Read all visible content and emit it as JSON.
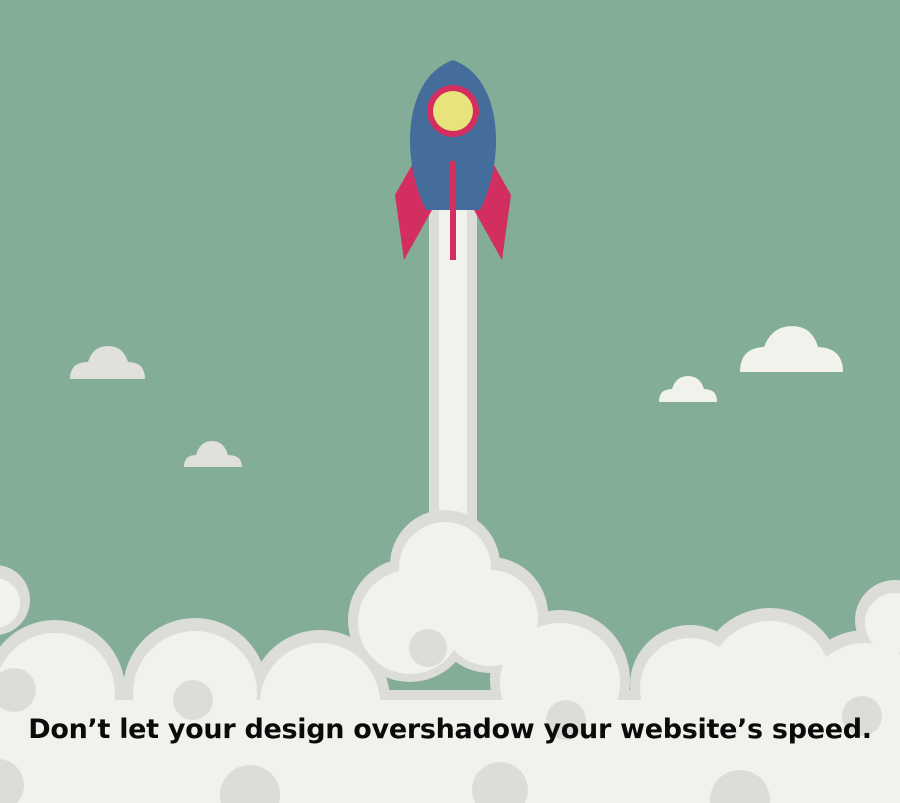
{
  "caption": "Don’t let your design overshadow your website’s speed.",
  "colors": {
    "sky": "#83ad97",
    "cloud_light": "#f2f2ed",
    "cloud_shade": "#dcdcd9",
    "rocket_body": "#446d9c",
    "rocket_fin": "#d22e5f",
    "rocket_window": "#e9e37b",
    "caption_text": "#0b0b0b"
  },
  "icons": {
    "rocket": "rocket-icon",
    "cloud": "cloud-icon"
  }
}
